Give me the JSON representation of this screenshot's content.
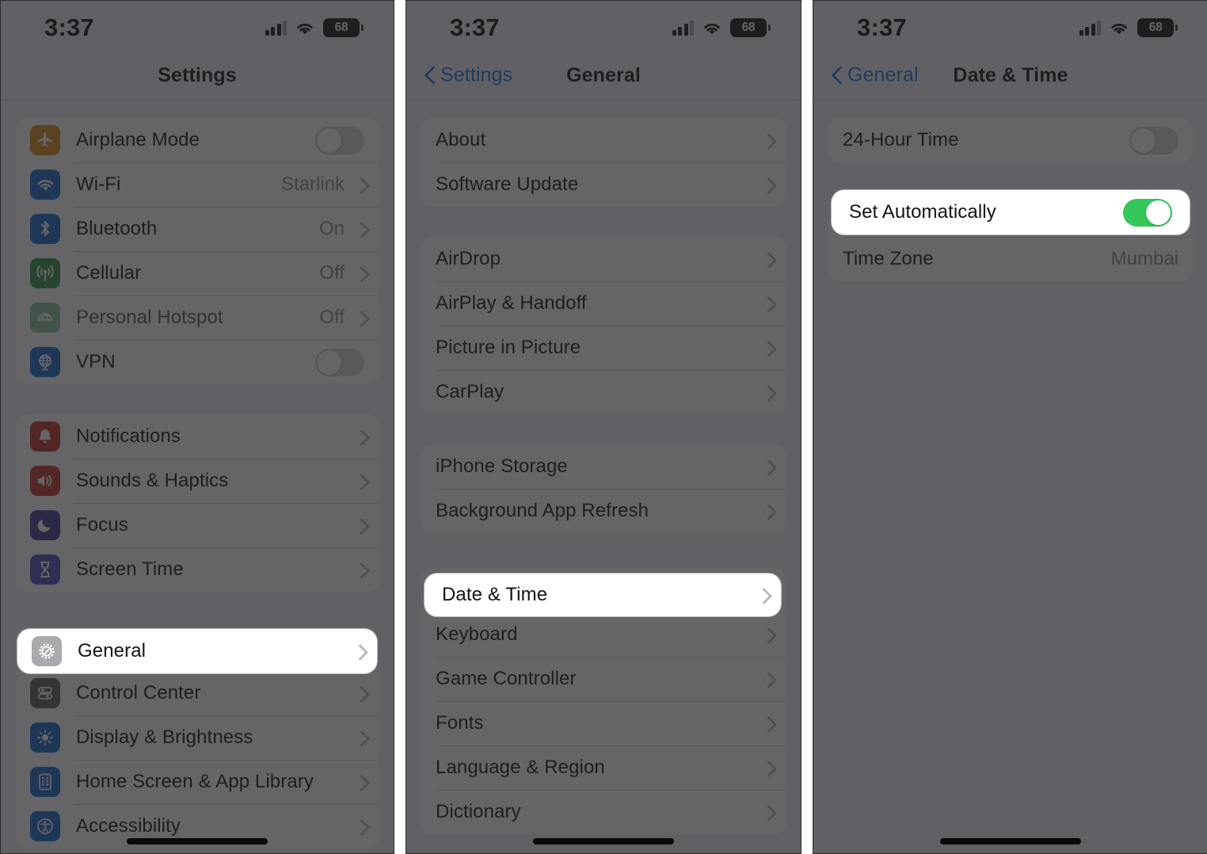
{
  "meta": {
    "accent_blue": "#1c6ee0",
    "toggle_on_green": "#34c759",
    "scrim": "rgba(35,35,38,0.70)"
  },
  "status_bar": {
    "time": "3:37",
    "battery": "68",
    "cellular_icon": "cellular-bars-icon",
    "wifi_icon": "wifi-icon",
    "battery_icon": "battery-icon"
  },
  "panels": [
    {
      "id": "settings",
      "nav": {
        "title": "Settings",
        "back": null
      },
      "groups": [
        {
          "rows": [
            {
              "label": "Airplane Mode",
              "icon": "airplane-icon",
              "icon_bg": "#d98a14",
              "control": "toggle",
              "toggle_on": false
            },
            {
              "label": "Wi-Fi",
              "icon": "wifi-icon",
              "icon_bg": "#1667c8",
              "value": "Starlink",
              "control": "chevron"
            },
            {
              "label": "Bluetooth",
              "icon": "bluetooth-icon",
              "icon_bg": "#1667c8",
              "value": "On",
              "control": "chevron"
            },
            {
              "label": "Cellular",
              "icon": "cellular-icon",
              "icon_bg": "#2e9141",
              "value": "Off",
              "control": "chevron"
            },
            {
              "label": "Personal Hotspot",
              "icon": "hotspot-icon",
              "icon_bg": "#2e9141",
              "value": "Off",
              "control": "chevron",
              "dim": true
            },
            {
              "label": "VPN",
              "icon": "vpn-globe-icon",
              "icon_bg": "#1667c8",
              "control": "toggle",
              "toggle_on": false
            }
          ]
        },
        {
          "rows": [
            {
              "label": "Notifications",
              "icon": "bell-icon",
              "icon_bg": "#c62f2a",
              "control": "chevron"
            },
            {
              "label": "Sounds & Haptics",
              "icon": "speaker-icon",
              "icon_bg": "#c62f2a",
              "control": "chevron"
            },
            {
              "label": "Focus",
              "icon": "moon-icon",
              "icon_bg": "#3b3a8f",
              "control": "chevron"
            },
            {
              "label": "Screen Time",
              "icon": "hourglass-icon",
              "icon_bg": "#4b4bbd",
              "control": "chevron"
            }
          ]
        },
        {
          "rows": [
            {
              "label": "General",
              "icon": "gear-icon",
              "icon_bg": "#8e8e93",
              "control": "chevron",
              "highlighted": true
            },
            {
              "label": "Control Center",
              "icon": "control-center-icon",
              "icon_bg": "#5a5a5f",
              "control": "chevron"
            },
            {
              "label": "Display & Brightness",
              "icon": "brightness-icon",
              "icon_bg": "#1667c8",
              "control": "chevron"
            },
            {
              "label": "Home Screen & App Library",
              "icon": "home-screen-icon",
              "icon_bg": "#1667c8",
              "control": "chevron"
            },
            {
              "label": "Accessibility",
              "icon": "accessibility-icon",
              "icon_bg": "#1667c8",
              "control": "chevron"
            }
          ]
        }
      ]
    },
    {
      "id": "general",
      "nav": {
        "title": "General",
        "back": "Settings"
      },
      "groups": [
        {
          "rows": [
            {
              "label": "About",
              "control": "chevron"
            },
            {
              "label": "Software Update",
              "control": "chevron"
            }
          ]
        },
        {
          "rows": [
            {
              "label": "AirDrop",
              "control": "chevron"
            },
            {
              "label": "AirPlay & Handoff",
              "control": "chevron"
            },
            {
              "label": "Picture in Picture",
              "control": "chevron"
            },
            {
              "label": "CarPlay",
              "control": "chevron"
            }
          ]
        },
        {
          "rows": [
            {
              "label": "iPhone Storage",
              "control": "chevron"
            },
            {
              "label": "Background App Refresh",
              "control": "chevron"
            }
          ]
        },
        {
          "rows": [
            {
              "label": "Date & Time",
              "control": "chevron",
              "highlighted": true
            },
            {
              "label": "Keyboard",
              "control": "chevron"
            },
            {
              "label": "Game Controller",
              "control": "chevron"
            },
            {
              "label": "Fonts",
              "control": "chevron"
            },
            {
              "label": "Language & Region",
              "control": "chevron"
            },
            {
              "label": "Dictionary",
              "control": "chevron"
            }
          ]
        }
      ]
    },
    {
      "id": "date-time",
      "nav": {
        "title": "Date & Time",
        "back": "General"
      },
      "groups": [
        {
          "rows": [
            {
              "label": "24-Hour Time",
              "control": "toggle",
              "toggle_on": false
            }
          ]
        },
        {
          "rows": [
            {
              "label": "Set Automatically",
              "control": "toggle",
              "toggle_on": true,
              "highlighted": true
            },
            {
              "label": "Time Zone",
              "value": "Mumbai",
              "control": "none"
            }
          ]
        }
      ]
    }
  ]
}
